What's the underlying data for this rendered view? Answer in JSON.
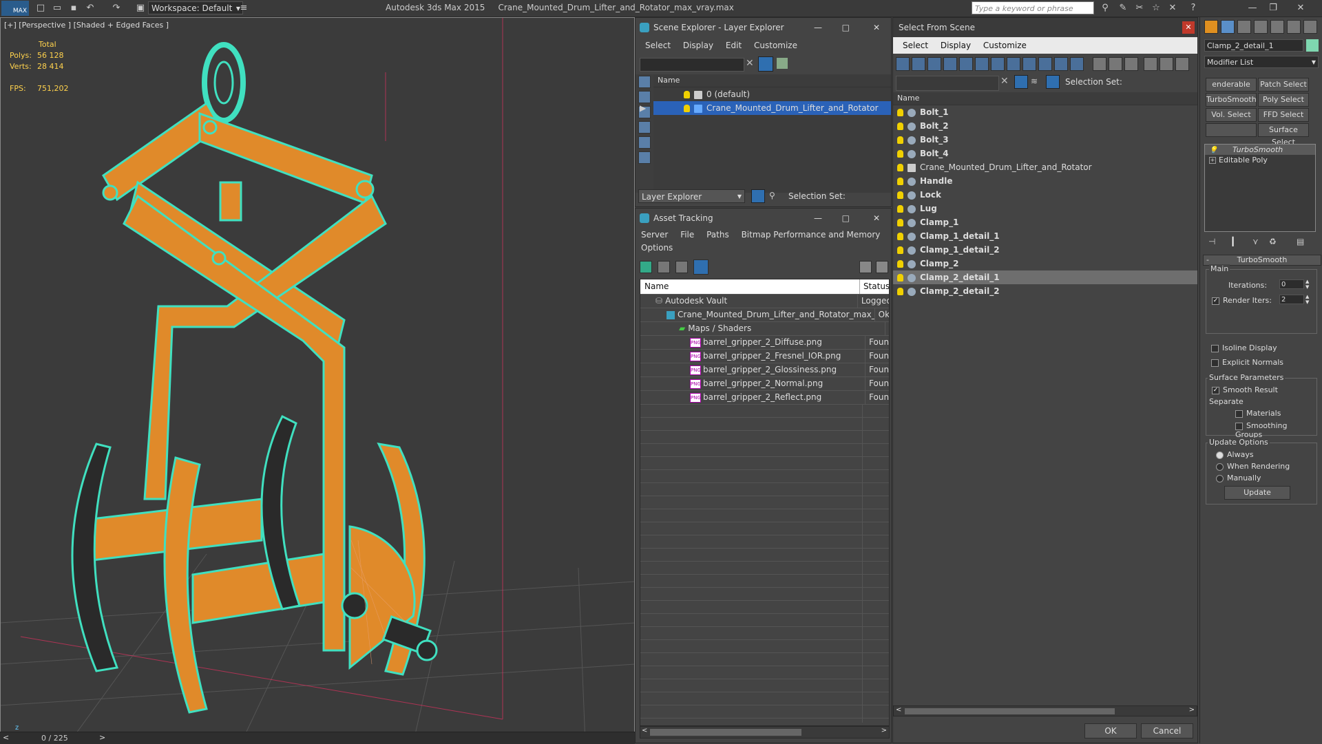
{
  "app": {
    "logo": "MAX",
    "workspace": "Workspace: Default",
    "app_title": "Autodesk 3ds Max  2015",
    "file_title": "Crane_Mounted_Drum_Lifter_and_Rotator_max_vray.max",
    "search_placeholder": "Type a keyword or phrase"
  },
  "viewport": {
    "label": "[+] [Perspective ] [Shaded + Edged Faces ]",
    "stats": {
      "total_label": "Total",
      "polys_label": "Polys:",
      "polys_value": "56 128",
      "verts_label": "Verts:",
      "verts_value": "28 414",
      "fps_label": "FPS:",
      "fps_value": "751,202"
    },
    "timeline": "0 / 225",
    "colors": {
      "wire": "#40e0c0",
      "body": "#e08a2a",
      "background": "#3b3b3b"
    }
  },
  "layer_explorer": {
    "title": "Scene Explorer - Layer Explorer",
    "menu": [
      "Select",
      "Display",
      "Edit",
      "Customize"
    ],
    "column_name": "Name",
    "rows": [
      "0 (default)",
      "Crane_Mounted_Drum_Lifter_and_Rotator"
    ],
    "footer_dropdown": "Layer Explorer",
    "selection_set": "Selection Set:"
  },
  "asset_tracking": {
    "title": "Asset Tracking",
    "menu": [
      "Server",
      "File",
      "Paths",
      "Bitmap Performance and Memory"
    ],
    "menu2": "Options",
    "col_name": "Name",
    "col_status": "Status",
    "rows": [
      {
        "name": "Autodesk Vault",
        "status": "Logged"
      },
      {
        "name": "Crane_Mounted_Drum_Lifter_and_Rotator_max_...",
        "status": "Ok"
      },
      {
        "name": "Maps / Shaders",
        "status": ""
      },
      {
        "name": "barrel_gripper_2_Diffuse.png",
        "status": "Found"
      },
      {
        "name": "barrel_gripper_2_Fresnel_IOR.png",
        "status": "Found"
      },
      {
        "name": "barrel_gripper_2_Glossiness.png",
        "status": "Found"
      },
      {
        "name": "barrel_gripper_2_Normal.png",
        "status": "Found"
      },
      {
        "name": "barrel_gripper_2_Reflect.png",
        "status": "Found"
      }
    ]
  },
  "select_from_scene": {
    "title": "Select From Scene",
    "menu": [
      "Select",
      "Display",
      "Customize"
    ],
    "selection_set": "Selection Set:",
    "column_name": "Name",
    "items": [
      "Bolt_1",
      "Bolt_2",
      "Bolt_3",
      "Bolt_4",
      "Crane_Mounted_Drum_Lifter_and_Rotator",
      "Handle",
      "Lock",
      "Lug",
      "Clamp_1",
      "Clamp_1_detail_1",
      "Clamp_1_detail_2",
      "Clamp_2",
      "Clamp_2_detail_1",
      "Clamp_2_detail_2"
    ],
    "selected": "Clamp_2_detail_1",
    "ok": "OK",
    "cancel": "Cancel"
  },
  "modify_panel": {
    "object_name": "Clamp_2_detail_1",
    "modifier_list": "Modifier List",
    "buttons": [
      "enderable Spli",
      "Patch Select",
      "TurboSmooth",
      "Poly Select",
      "Vol. Select",
      "FFD Select",
      "",
      "Surface Select"
    ],
    "stack": [
      "TurboSmooth",
      "Editable Poly"
    ],
    "rollout_title": "TurboSmooth",
    "main_label": "Main",
    "iterations_label": "Iterations:",
    "iterations_value": "0",
    "render_iters_label": "Render Iters:",
    "render_iters_value": "2",
    "isoline": "Isoline Display",
    "explicit": "Explicit Normals",
    "surface_params": "Surface Parameters",
    "smooth_result": "Smooth Result",
    "separate": "Separate",
    "materials": "Materials",
    "smoothing_groups": "Smoothing Groups",
    "update_options": "Update Options",
    "always": "Always",
    "when_rendering": "When Rendering",
    "manually": "Manually",
    "update_button": "Update"
  }
}
